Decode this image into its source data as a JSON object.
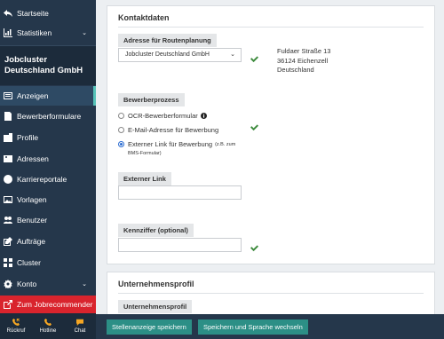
{
  "sidebar": {
    "home": "Startseite",
    "stats": "Statistiken",
    "company": "Jobcluster Deutschland GmbH",
    "items": [
      {
        "label": "Anzeigen"
      },
      {
        "label": "Bewerberformulare"
      },
      {
        "label": "Profile"
      },
      {
        "label": "Adressen"
      },
      {
        "label": "Karriereportale"
      },
      {
        "label": "Vorlagen"
      },
      {
        "label": "Benutzer"
      },
      {
        "label": "Aufträge"
      },
      {
        "label": "Cluster"
      },
      {
        "label": "Konto"
      }
    ],
    "jobrecommender": "Zum Jobrecommender",
    "bottom": [
      {
        "label": "Rückruf",
        "icon": "phone-callback-icon"
      },
      {
        "label": "Hotline",
        "icon": "phone-icon"
      },
      {
        "label": "Chat",
        "icon": "chat-icon"
      }
    ]
  },
  "contact": {
    "title": "Kontaktdaten",
    "route_label": "Adresse für Routenplanung",
    "route_value": "Jobcluster Deutschland GmbH",
    "address": [
      "Fuldaer Straße 13",
      "36124 Eichenzell",
      "Deutschland"
    ],
    "process_label": "Bewerberprozess",
    "options": [
      {
        "label": "OCR-Bewerberformular",
        "selected": false
      },
      {
        "label": "E-Mail-Adresse für Bewerbung",
        "selected": false
      },
      {
        "label": "Externer Link für Bewerbung",
        "hint": "(z.B. zum",
        "selected": true
      }
    ],
    "option_hint2": "BMS-Formular)",
    "external_label": "Externer Link",
    "external_value": "",
    "ref_label": "Kennziffer (optional)",
    "ref_value": ""
  },
  "profile": {
    "title": "Unternehmensprofil",
    "label": "Unternehmensprofil"
  },
  "footer": {
    "save": "Stellenanzeige speichern",
    "save_lang": "Speichern und Sprache wechseln"
  },
  "colors": {
    "sidebar": "#25374b",
    "accent": "#57c3b8",
    "button": "#2c8f86",
    "danger": "#d9242d",
    "check": "#3c8a3c"
  }
}
